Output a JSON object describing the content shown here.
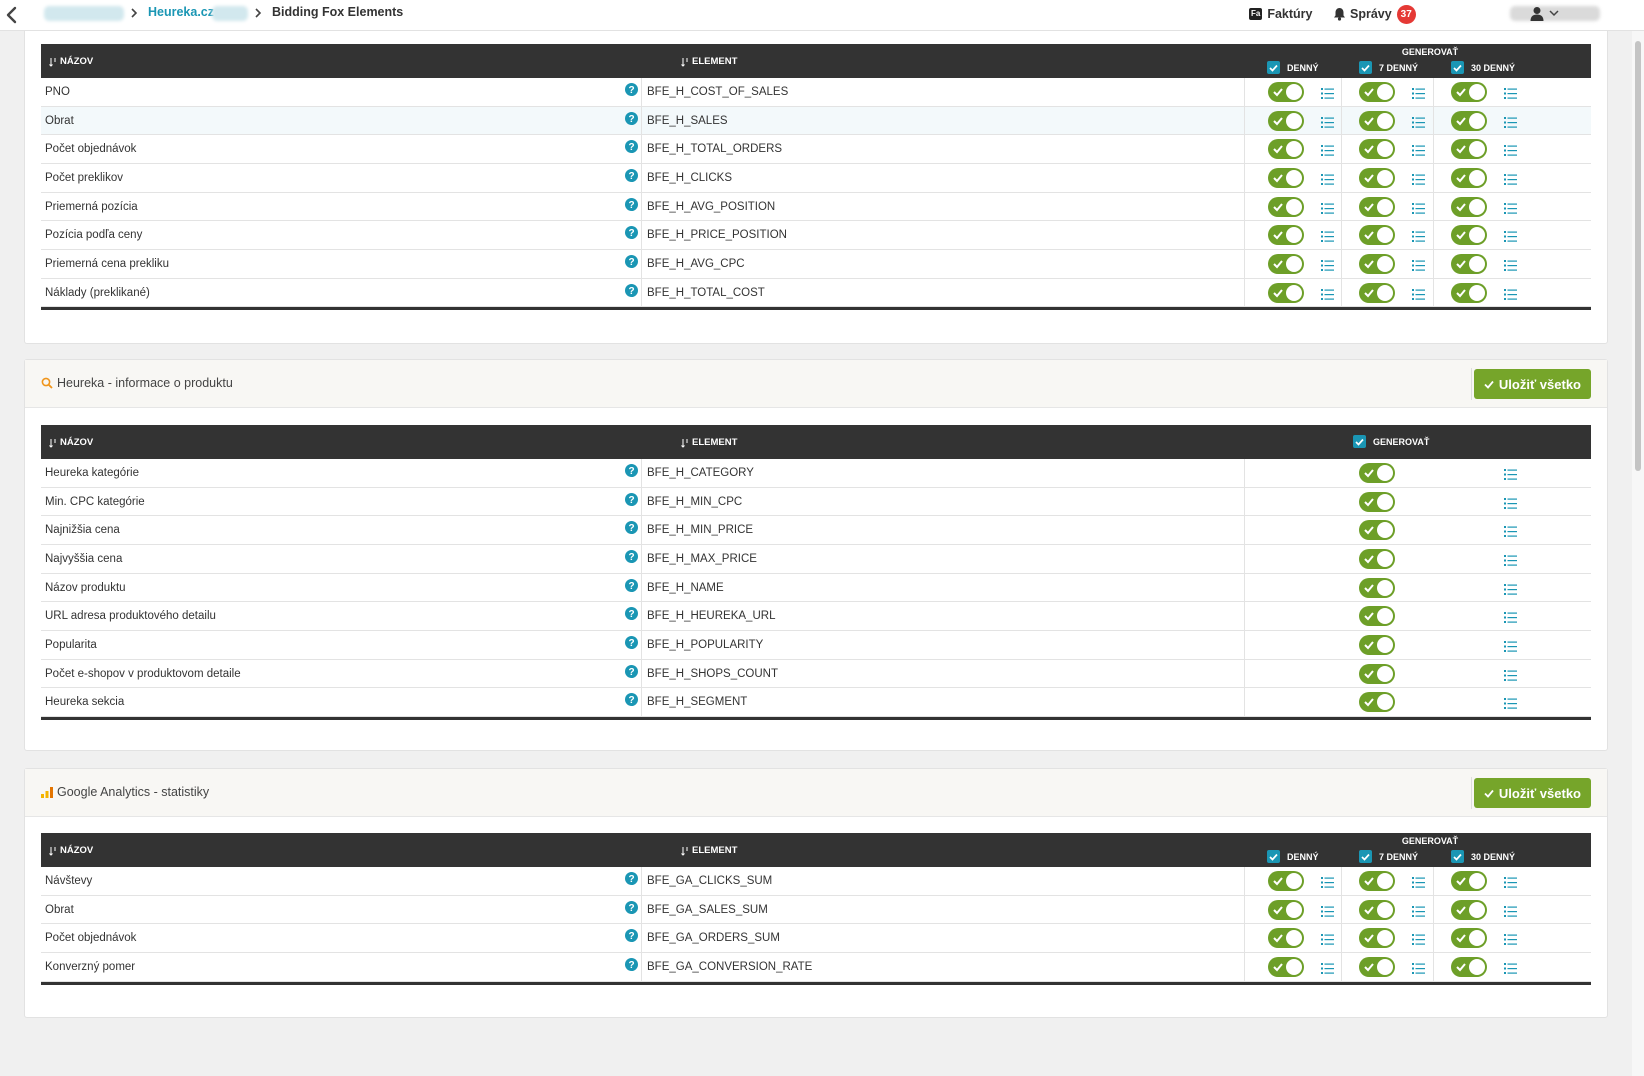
{
  "breadcrumb": {
    "link": "Heureka.cz",
    "current": "Bidding Fox Elements"
  },
  "topbar": {
    "invoices_label": "Faktúry",
    "invoices_badge": "Fa",
    "messages_label": "Správy",
    "messages_count": "37"
  },
  "colors": {
    "accent": "#1a96b4",
    "toggle_on": "#6d9f28",
    "save_button": "#76a52a",
    "header_dark": "#333333",
    "badge_red": "#e53935"
  },
  "columns": {
    "name": "NÁZOV",
    "element": "ELEMENT",
    "generate": "GENEROVAŤ",
    "daily": "DENNÝ",
    "weekly": "7 DENNÝ",
    "monthly": "30 DENNÝ"
  },
  "sections": [
    {
      "title": "",
      "save_label": "",
      "rows": [
        {
          "name": "PNO",
          "element": "BFE_H_COST_OF_SALES"
        },
        {
          "name": "Obrat",
          "element": "BFE_H_SALES"
        },
        {
          "name": "Počet objednávok",
          "element": "BFE_H_TOTAL_ORDERS"
        },
        {
          "name": "Počet preklikov",
          "element": "BFE_H_CLICKS"
        },
        {
          "name": "Priemerná pozícia",
          "element": "BFE_H_AVG_POSITION"
        },
        {
          "name": "Pozícia podľa ceny",
          "element": "BFE_H_PRICE_POSITION"
        },
        {
          "name": "Priemerná cena prekliku",
          "element": "BFE_H_AVG_CPC"
        },
        {
          "name": "Náklady (preklikané)",
          "element": "BFE_H_TOTAL_COST"
        }
      ]
    },
    {
      "title": "Heureka - informace o produktu",
      "save_label": "Uložiť všetko",
      "rows": [
        {
          "name": "Heureka kategórie",
          "element": "BFE_H_CATEGORY"
        },
        {
          "name": "Min. CPC kategórie",
          "element": "BFE_H_MIN_CPC"
        },
        {
          "name": "Najnižšia cena",
          "element": "BFE_H_MIN_PRICE"
        },
        {
          "name": "Najvyššia cena",
          "element": "BFE_H_MAX_PRICE"
        },
        {
          "name": "Názov produktu",
          "element": "BFE_H_NAME"
        },
        {
          "name": "URL adresa produktového detailu",
          "element": "BFE_H_HEUREKA_URL"
        },
        {
          "name": "Popularita",
          "element": "BFE_H_POPULARITY"
        },
        {
          "name": "Počet e-shopov v produktovom detaile",
          "element": "BFE_H_SHOPS_COUNT"
        },
        {
          "name": "Heureka sekcia",
          "element": "BFE_H_SEGMENT"
        }
      ]
    },
    {
      "title": "Google Analytics - statistiky",
      "save_label": "Uložiť všetko",
      "rows": [
        {
          "name": "Návštevy",
          "element": "BFE_GA_CLICKS_SUM"
        },
        {
          "name": "Obrat",
          "element": "BFE_GA_SALES_SUM"
        },
        {
          "name": "Počet objednávok",
          "element": "BFE_GA_ORDERS_SUM"
        },
        {
          "name": "Konverzný pomer",
          "element": "BFE_GA_CONVERSION_RATE"
        }
      ]
    }
  ]
}
